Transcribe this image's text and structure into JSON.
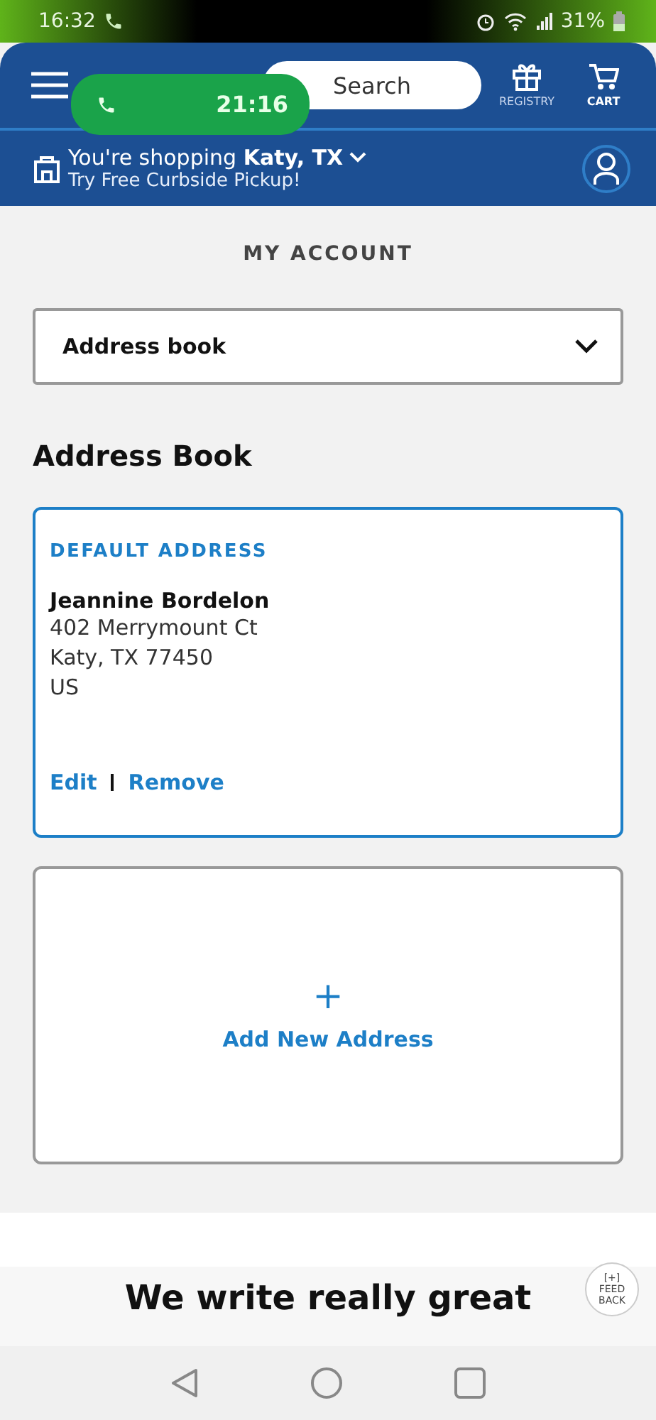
{
  "status_bar": {
    "time": "16:32",
    "battery": "31%"
  },
  "call_pill": {
    "duration": "21:16"
  },
  "header": {
    "search": {
      "placeholder": "Search"
    },
    "registry": "REGISTRY",
    "cart": "CART"
  },
  "location": {
    "prefix": "You're shopping ",
    "city": "Katy, TX",
    "subtitle": "Try Free Curbside Pickup!"
  },
  "page_title": "MY ACCOUNT",
  "section_select": {
    "value": "Address book"
  },
  "heading": "Address Book",
  "address_card": {
    "label": "DEFAULT ADDRESS",
    "name": "Jeannine Bordelon",
    "lines": [
      "402 Merrymount Ct",
      "Katy, TX 77450",
      "US"
    ],
    "actions": [
      "Edit",
      "Remove"
    ]
  },
  "add_card": {
    "icon": "+",
    "label": "Add New Address"
  },
  "feedback": {
    "mark": "[+]",
    "label": "FEED BACK"
  },
  "footer_heading": "We write really great"
}
